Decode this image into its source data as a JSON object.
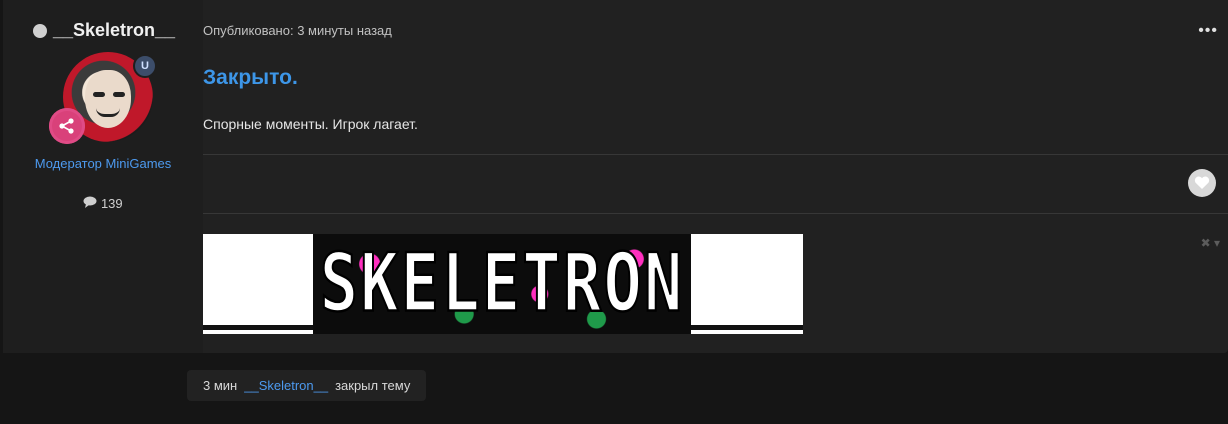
{
  "author": {
    "name": "__Skeletron__",
    "role": "Модератор MiniGames",
    "badge_letter": "U",
    "posts_count": "139"
  },
  "post": {
    "meta": "Опубликовано: 3 минуты назад",
    "menu_label": "•••",
    "title": "Закрыто.",
    "body": "Спорные моменты. Игрок лагает.",
    "signature_text": "SKELETRON",
    "signature_close": "✖ ▾"
  },
  "event": {
    "time": "3 мин",
    "user": "__Skeletron__",
    "action": "закрыл тему"
  },
  "colors": {
    "accent": "#3d96e8",
    "link": "#4d9aef",
    "background": "#151515",
    "panel": "#212121"
  }
}
